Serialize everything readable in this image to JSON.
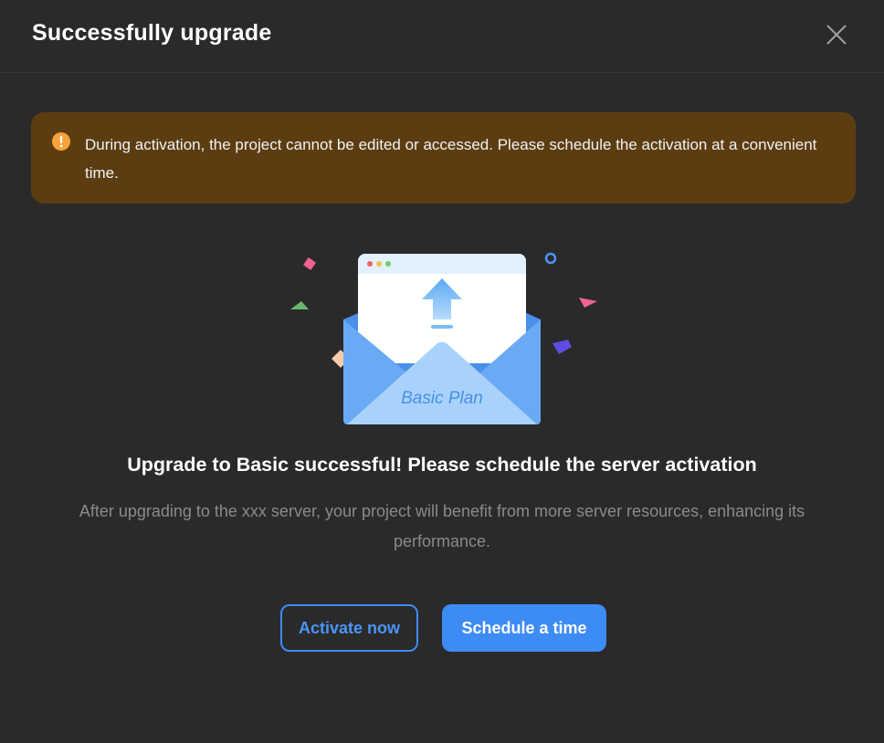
{
  "dialog": {
    "title": "Successfully upgrade",
    "close_icon": "close-icon"
  },
  "alert": {
    "icon": "exclamation-circle-icon",
    "text": "During activation, the project cannot be edited or accessed. Please schedule the activation at a convenient time.",
    "colors": {
      "background": "#5c3d12",
      "icon": "#f7a23b"
    }
  },
  "illustration": {
    "icon": "envelope-upgrade-illustration",
    "plan_label": "Basic Plan"
  },
  "content": {
    "headline": "Upgrade to Basic successful! Please schedule the server activation",
    "description": "After upgrading to the xxx server, your project will benefit from more server resources, enhancing its performance."
  },
  "actions": {
    "activate_label": "Activate now",
    "schedule_label": "Schedule a time"
  },
  "colors": {
    "accent": "#3d8bf5",
    "background": "#2a2a2b"
  }
}
